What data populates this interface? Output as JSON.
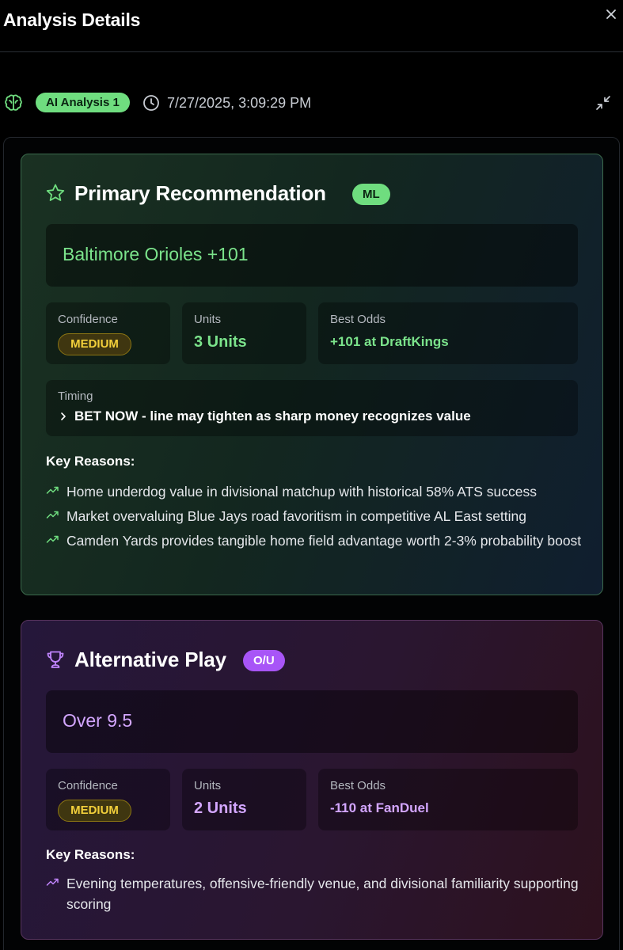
{
  "header": {
    "title": "Analysis Details"
  },
  "meta": {
    "analysis_label": "AI Analysis 1",
    "timestamp": "7/27/2025, 3:09:29 PM"
  },
  "primary": {
    "title": "Primary Recommendation",
    "type_badge": "ML",
    "pick": "Baltimore Orioles +101",
    "confidence_label": "Confidence",
    "confidence_value": "MEDIUM",
    "units_label": "Units",
    "units_value": "3 Units",
    "odds_label": "Best Odds",
    "odds_value": "+101 at DraftKings",
    "timing_label": "Timing",
    "timing_value": "BET NOW - line may tighten as sharp money recognizes value",
    "reasons_title": "Key Reasons:",
    "reasons": [
      "Home underdog value in divisional matchup with historical 58% ATS success",
      "Market overvaluing Blue Jays road favoritism in competitive AL East setting",
      "Camden Yards provides tangible home field advantage worth 2-3% probability boost"
    ]
  },
  "alternative": {
    "title": "Alternative Play",
    "type_badge": "O/U",
    "pick": "Over 9.5",
    "confidence_label": "Confidence",
    "confidence_value": "MEDIUM",
    "units_label": "Units",
    "units_value": "2 Units",
    "odds_label": "Best Odds",
    "odds_value": "-110 at FanDuel",
    "reasons_title": "Key Reasons:",
    "reasons": [
      "Evening temperatures, offensive-friendly venue, and divisional familiarity supporting scoring"
    ]
  },
  "colors": {
    "accent_green": "#6fdd7f",
    "accent_purple": "#a855f7",
    "confidence_yellow": "#f2cf3b"
  },
  "icons": {
    "close": "close-icon",
    "brain": "brain-icon",
    "clock": "clock-icon",
    "collapse": "minimize-icon",
    "primary": "star-icon",
    "alternative": "trophy-icon",
    "reason": "trending-up-icon",
    "timing": "chevron-right-icon"
  }
}
